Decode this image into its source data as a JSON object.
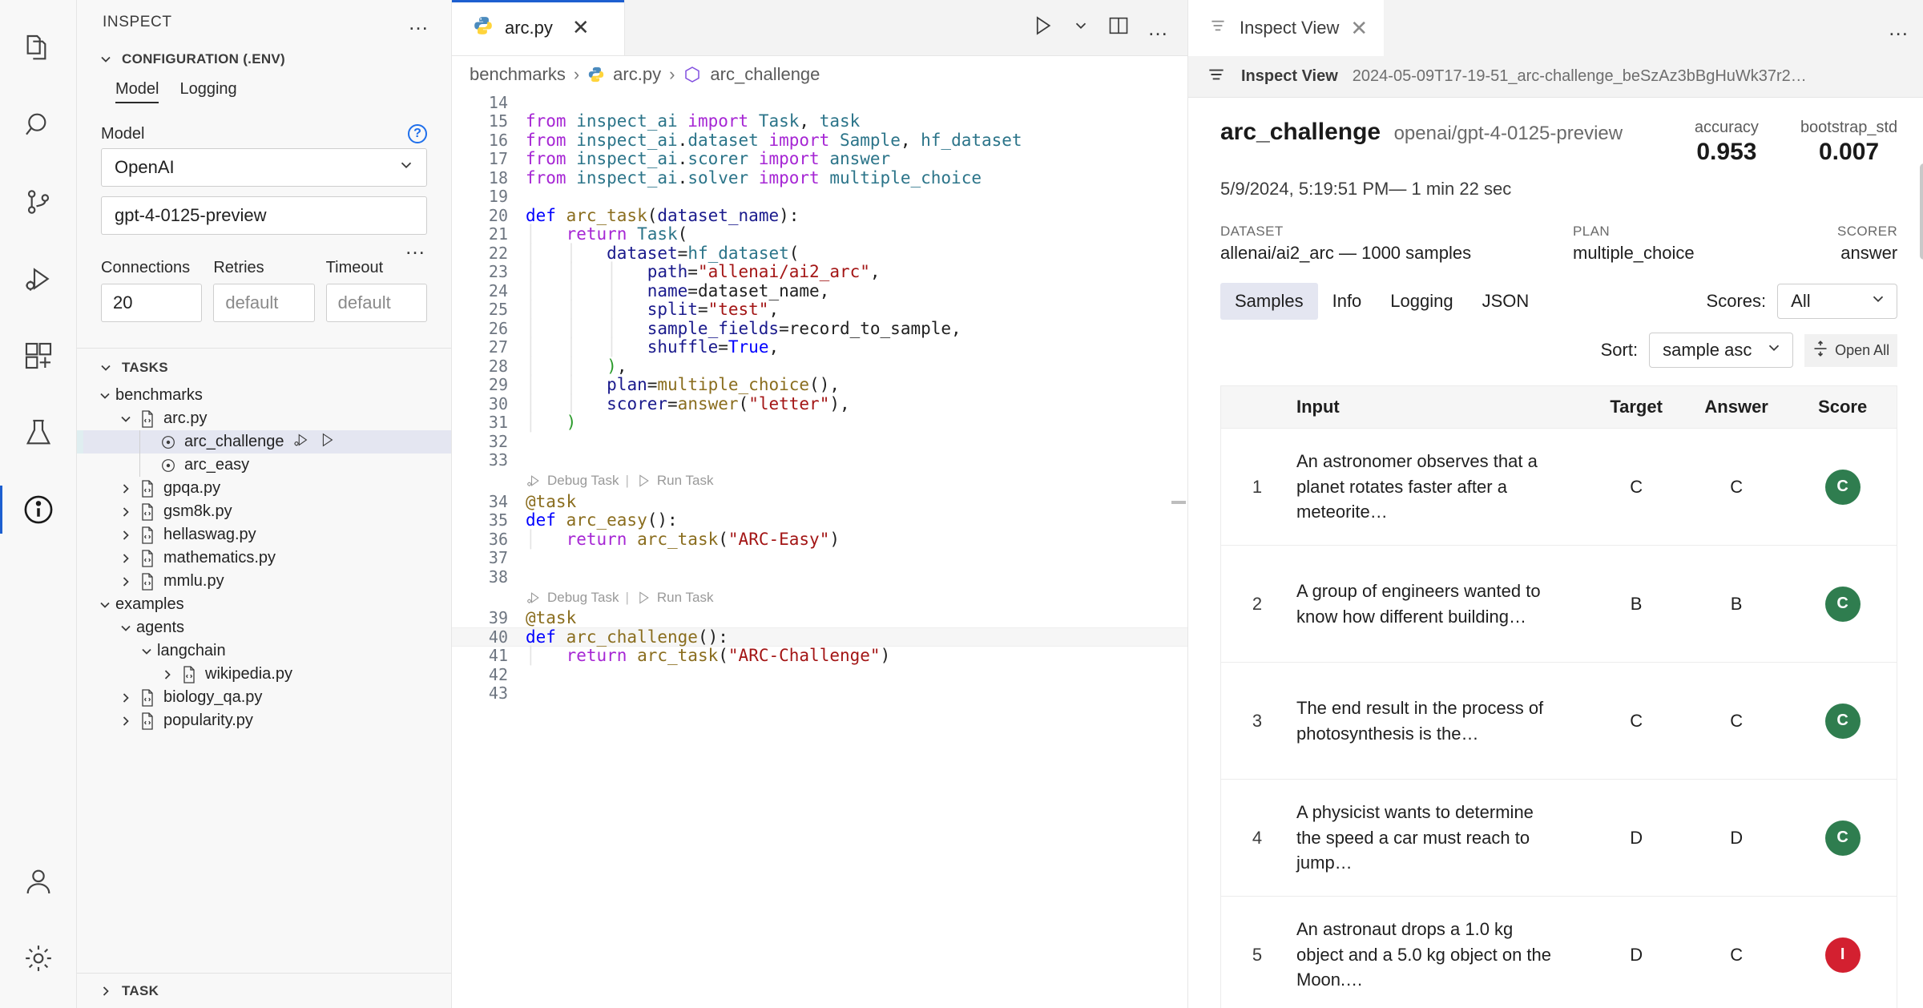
{
  "activity_bar": {
    "items": [
      {
        "name": "explorer-icon",
        "label": "Explorer"
      },
      {
        "name": "search-icon",
        "label": "Search"
      },
      {
        "name": "source-control-icon",
        "label": "Source Control"
      },
      {
        "name": "run-debug-icon",
        "label": "Run and Debug"
      },
      {
        "name": "extensions-icon",
        "label": "Extensions"
      },
      {
        "name": "testing-icon",
        "label": "Testing"
      },
      {
        "name": "inspect-icon",
        "label": "Inspect"
      }
    ],
    "bottom_items": [
      {
        "name": "accounts-icon",
        "label": "Accounts"
      },
      {
        "name": "settings-gear-icon",
        "label": "Manage"
      }
    ]
  },
  "sidebar": {
    "title": "INSPECT",
    "more_actions": "…",
    "configuration": {
      "header": "CONFIGURATION (.ENV)",
      "tabs": [
        {
          "label": "Model",
          "active": true
        },
        {
          "label": "Logging",
          "active": false
        }
      ],
      "model_label": "Model",
      "help_icon": "?",
      "provider_value": "OpenAI",
      "model_value": "gpt-4-0125-preview",
      "more_dots": "…",
      "fields": [
        {
          "label": "Connections",
          "value": "20",
          "placeholder": false
        },
        {
          "label": "Retries",
          "value": "default",
          "placeholder": true
        },
        {
          "label": "Timeout",
          "value": "default",
          "placeholder": true
        }
      ]
    },
    "tasks": {
      "header": "TASKS",
      "tree": [
        {
          "label": "benchmarks",
          "depth": 0,
          "twisty": "down",
          "icon": "none",
          "selected": false
        },
        {
          "label": "arc.py",
          "depth": 1,
          "twisty": "down",
          "icon": "code-file-icon",
          "selected": false
        },
        {
          "label": "arc_challenge",
          "depth": 2,
          "twisty": "none",
          "icon": "task-target-icon",
          "selected": true,
          "actions": [
            "debug-task-icon",
            "run-task-icon"
          ]
        },
        {
          "label": "arc_easy",
          "depth": 2,
          "twisty": "none",
          "icon": "task-target-icon",
          "selected": false
        },
        {
          "label": "gpqa.py",
          "depth": 1,
          "twisty": "right",
          "icon": "code-file-icon",
          "selected": false
        },
        {
          "label": "gsm8k.py",
          "depth": 1,
          "twisty": "right",
          "icon": "code-file-icon",
          "selected": false
        },
        {
          "label": "hellaswag.py",
          "depth": 1,
          "twisty": "right",
          "icon": "code-file-icon",
          "selected": false
        },
        {
          "label": "mathematics.py",
          "depth": 1,
          "twisty": "right",
          "icon": "code-file-icon",
          "selected": false
        },
        {
          "label": "mmlu.py",
          "depth": 1,
          "twisty": "right",
          "icon": "code-file-icon",
          "selected": false
        },
        {
          "label": "examples",
          "depth": 0,
          "twisty": "down",
          "icon": "none",
          "selected": false
        },
        {
          "label": "agents",
          "depth": 1,
          "twisty": "down",
          "icon": "none",
          "selected": false
        },
        {
          "label": "langchain",
          "depth": 2,
          "twisty": "down",
          "icon": "none",
          "selected": false
        },
        {
          "label": "wikipedia.py",
          "depth": 3,
          "twisty": "right",
          "icon": "code-file-icon",
          "selected": false
        },
        {
          "label": "biology_qa.py",
          "depth": 1,
          "twisty": "right",
          "icon": "code-file-icon",
          "selected": false
        },
        {
          "label": "popularity.py",
          "depth": 1,
          "twisty": "right",
          "icon": "code-file-icon",
          "selected": false
        }
      ]
    },
    "task_section": {
      "header": "TASK"
    }
  },
  "editor": {
    "tab": {
      "label": "arc.py",
      "icon": "python-icon",
      "close": "✕"
    },
    "actions": [
      "run-play-icon",
      "run-dropdown-chevron-icon",
      "split-editor-icon",
      "editor-more-icon"
    ],
    "breadcrumbs": [
      {
        "label": "benchmarks",
        "icon": "none"
      },
      {
        "label": "arc.py",
        "icon": "python-icon"
      },
      {
        "label": "arc_challenge",
        "icon": "symbol-method-icon"
      }
    ],
    "codelens": {
      "debug": "Debug Task",
      "separator": "|",
      "run": "Run Task"
    },
    "lines": [
      {
        "n": 14,
        "segs": []
      },
      {
        "n": 15,
        "segs": [
          {
            "t": "from ",
            "c": "k"
          },
          {
            "t": "inspect_ai ",
            "c": "id"
          },
          {
            "t": "import ",
            "c": "k"
          },
          {
            "t": "Task",
            "c": "cls"
          },
          {
            "t": ", ",
            "c": "op"
          },
          {
            "t": "task",
            "c": "cls"
          }
        ]
      },
      {
        "n": 16,
        "segs": [
          {
            "t": "from ",
            "c": "k"
          },
          {
            "t": "inspect_ai",
            "c": "id"
          },
          {
            "t": ".",
            "c": "op"
          },
          {
            "t": "dataset ",
            "c": "id"
          },
          {
            "t": "import ",
            "c": "k"
          },
          {
            "t": "Sample",
            "c": "cls"
          },
          {
            "t": ", ",
            "c": "op"
          },
          {
            "t": "hf_dataset",
            "c": "cls"
          }
        ]
      },
      {
        "n": 17,
        "segs": [
          {
            "t": "from ",
            "c": "k"
          },
          {
            "t": "inspect_ai",
            "c": "id"
          },
          {
            "t": ".",
            "c": "op"
          },
          {
            "t": "scorer ",
            "c": "id"
          },
          {
            "t": "import ",
            "c": "k"
          },
          {
            "t": "answer",
            "c": "cls"
          }
        ]
      },
      {
        "n": 18,
        "segs": [
          {
            "t": "from ",
            "c": "k"
          },
          {
            "t": "inspect_ai",
            "c": "id"
          },
          {
            "t": ".",
            "c": "op"
          },
          {
            "t": "solver ",
            "c": "id"
          },
          {
            "t": "import ",
            "c": "k"
          },
          {
            "t": "multiple_choice",
            "c": "cls"
          }
        ]
      },
      {
        "n": 19,
        "segs": []
      },
      {
        "n": 20,
        "segs": [
          {
            "t": "def ",
            "c": "kd"
          },
          {
            "t": "arc_task",
            "c": "fn"
          },
          {
            "t": "(",
            "c": "op"
          },
          {
            "t": "dataset_name",
            "c": "pa"
          },
          {
            "t": "):",
            "c": "op"
          }
        ]
      },
      {
        "n": 21,
        "segs": [
          {
            "t": "    ",
            "c": "op"
          },
          {
            "t": "return ",
            "c": "k"
          },
          {
            "t": "Task",
            "c": "cls"
          },
          {
            "t": "(",
            "c": "op"
          }
        ]
      },
      {
        "n": 22,
        "segs": [
          {
            "t": "        ",
            "c": "op"
          },
          {
            "t": "dataset",
            "c": "pa"
          },
          {
            "t": "=",
            "c": "op"
          },
          {
            "t": "hf_dataset",
            "c": "cls"
          },
          {
            "t": "(",
            "c": "op"
          }
        ]
      },
      {
        "n": 23,
        "segs": [
          {
            "t": "            ",
            "c": "op"
          },
          {
            "t": "path",
            "c": "pa"
          },
          {
            "t": "=",
            "c": "op"
          },
          {
            "t": "\"allenai/ai2_arc\"",
            "c": "st"
          },
          {
            "t": ",",
            "c": "op"
          }
        ]
      },
      {
        "n": 24,
        "segs": [
          {
            "t": "            ",
            "c": "op"
          },
          {
            "t": "name",
            "c": "pa"
          },
          {
            "t": "=",
            "c": "op"
          },
          {
            "t": "dataset_name",
            "c": "op"
          },
          {
            "t": ",",
            "c": "op"
          }
        ]
      },
      {
        "n": 25,
        "segs": [
          {
            "t": "            ",
            "c": "op"
          },
          {
            "t": "split",
            "c": "pa"
          },
          {
            "t": "=",
            "c": "op"
          },
          {
            "t": "\"test\"",
            "c": "st"
          },
          {
            "t": ",",
            "c": "op"
          }
        ]
      },
      {
        "n": 26,
        "segs": [
          {
            "t": "            ",
            "c": "op"
          },
          {
            "t": "sample_fields",
            "c": "pa"
          },
          {
            "t": "=",
            "c": "op"
          },
          {
            "t": "record_to_sample",
            "c": "op"
          },
          {
            "t": ",",
            "c": "op"
          }
        ]
      },
      {
        "n": 27,
        "segs": [
          {
            "t": "            ",
            "c": "op"
          },
          {
            "t": "shuffle",
            "c": "pa"
          },
          {
            "t": "=",
            "c": "op"
          },
          {
            "t": "True",
            "c": "kd"
          },
          {
            "t": ",",
            "c": "op"
          }
        ]
      },
      {
        "n": 28,
        "segs": [
          {
            "t": "        ",
            "c": "op"
          },
          {
            "t": ")",
            "c": "br"
          },
          {
            "t": ",",
            "c": "op"
          }
        ]
      },
      {
        "n": 29,
        "segs": [
          {
            "t": "        ",
            "c": "op"
          },
          {
            "t": "plan",
            "c": "pa"
          },
          {
            "t": "=",
            "c": "op"
          },
          {
            "t": "multiple_choice",
            "c": "fn"
          },
          {
            "t": "(),",
            "c": "op"
          }
        ]
      },
      {
        "n": 30,
        "segs": [
          {
            "t": "        ",
            "c": "op"
          },
          {
            "t": "scorer",
            "c": "pa"
          },
          {
            "t": "=",
            "c": "op"
          },
          {
            "t": "answer",
            "c": "fn"
          },
          {
            "t": "(",
            "c": "op"
          },
          {
            "t": "\"letter\"",
            "c": "st"
          },
          {
            "t": "),",
            "c": "op"
          }
        ]
      },
      {
        "n": 31,
        "segs": [
          {
            "t": "    ",
            "c": "op"
          },
          {
            "t": ")",
            "c": "br"
          }
        ]
      },
      {
        "n": 32,
        "segs": []
      },
      {
        "n": 33,
        "segs": []
      },
      {
        "n": "lens",
        "segs": []
      },
      {
        "n": 34,
        "segs": [
          {
            "t": "@task",
            "c": "dec"
          }
        ]
      },
      {
        "n": 35,
        "segs": [
          {
            "t": "def ",
            "c": "kd"
          },
          {
            "t": "arc_easy",
            "c": "fn"
          },
          {
            "t": "():",
            "c": "op"
          }
        ]
      },
      {
        "n": 36,
        "segs": [
          {
            "t": "    ",
            "c": "op"
          },
          {
            "t": "return ",
            "c": "k"
          },
          {
            "t": "arc_task",
            "c": "fn"
          },
          {
            "t": "(",
            "c": "op"
          },
          {
            "t": "\"ARC-Easy\"",
            "c": "st"
          },
          {
            "t": ")",
            "c": "op"
          }
        ]
      },
      {
        "n": 37,
        "segs": []
      },
      {
        "n": 38,
        "segs": []
      },
      {
        "n": "lens",
        "segs": []
      },
      {
        "n": 39,
        "segs": [
          {
            "t": "@task",
            "c": "dec"
          }
        ]
      },
      {
        "n": 40,
        "segs": [
          {
            "t": "def ",
            "c": "kd"
          },
          {
            "t": "arc_challenge",
            "c": "fn"
          },
          {
            "t": "():",
            "c": "op"
          }
        ],
        "current": true
      },
      {
        "n": 41,
        "segs": [
          {
            "t": "    ",
            "c": "op"
          },
          {
            "t": "return ",
            "c": "k"
          },
          {
            "t": "arc_task",
            "c": "fn"
          },
          {
            "t": "(",
            "c": "op"
          },
          {
            "t": "\"ARC-Challenge\"",
            "c": "st"
          },
          {
            "t": ")",
            "c": "op"
          }
        ]
      },
      {
        "n": 42,
        "segs": []
      },
      {
        "n": 43,
        "segs": []
      }
    ]
  },
  "inspect_view": {
    "tab": {
      "label": "Inspect View",
      "icon": "list-icon",
      "close": "✕"
    },
    "more_actions": "…",
    "subbar": {
      "title": "Inspect View",
      "log_file": "2024-05-09T17-19-51_arc-challenge_beSzAz3bBgHuWk37r2…"
    },
    "header": {
      "task_name": "arc_challenge",
      "model": "openai/gpt-4-0125-preview",
      "timestamp": "5/9/2024, 5:19:51 PM— 1 min 22 sec",
      "metrics": [
        {
          "name": "accuracy",
          "value": "0.953"
        },
        {
          "name": "bootstrap_std",
          "value": "0.007"
        }
      ],
      "meta": [
        {
          "key": "DATASET",
          "value": "allenai/ai2_arc — 1000 samples"
        },
        {
          "key": "PLAN",
          "value": "multiple_choice"
        },
        {
          "key": "SCORER",
          "value": "answer"
        }
      ]
    },
    "tabs": [
      {
        "label": "Samples",
        "active": true
      },
      {
        "label": "Info",
        "active": false
      },
      {
        "label": "Logging",
        "active": false
      },
      {
        "label": "JSON",
        "active": false
      }
    ],
    "controls": {
      "scores_label": "Scores:",
      "scores_value": "All",
      "sort_label": "Sort:",
      "sort_value": "sample asc",
      "open_all_label": "Open All"
    },
    "table": {
      "columns": [
        "",
        "Input",
        "Target",
        "Answer",
        "Score"
      ],
      "rows": [
        {
          "idx": "1",
          "input": "An astronomer observes that a planet rotates faster after a meteorite…",
          "target": "C",
          "answer": "C",
          "score": "C",
          "score_kind": "correct"
        },
        {
          "idx": "2",
          "input": "A group of engineers wanted to know how different building…",
          "target": "B",
          "answer": "B",
          "score": "C",
          "score_kind": "correct"
        },
        {
          "idx": "3",
          "input": "The end result in the process of photosynthesis is the…",
          "target": "C",
          "answer": "C",
          "score": "C",
          "score_kind": "correct"
        },
        {
          "idx": "4",
          "input": "A physicist wants to determine the speed a car must reach to jump…",
          "target": "D",
          "answer": "D",
          "score": "C",
          "score_kind": "correct"
        },
        {
          "idx": "5",
          "input": "An astronaut drops a 1.0 kg object and a 5.0 kg object on the Moon.…",
          "target": "D",
          "answer": "C",
          "score": "I",
          "score_kind": "incorrect"
        }
      ]
    }
  },
  "colors": {
    "accent": "#1d5fd0",
    "selected_tree": "#e4e6f1",
    "correct": "#2f7d4f",
    "incorrect": "#d32030",
    "panel_bg": "#f8f8f8"
  }
}
